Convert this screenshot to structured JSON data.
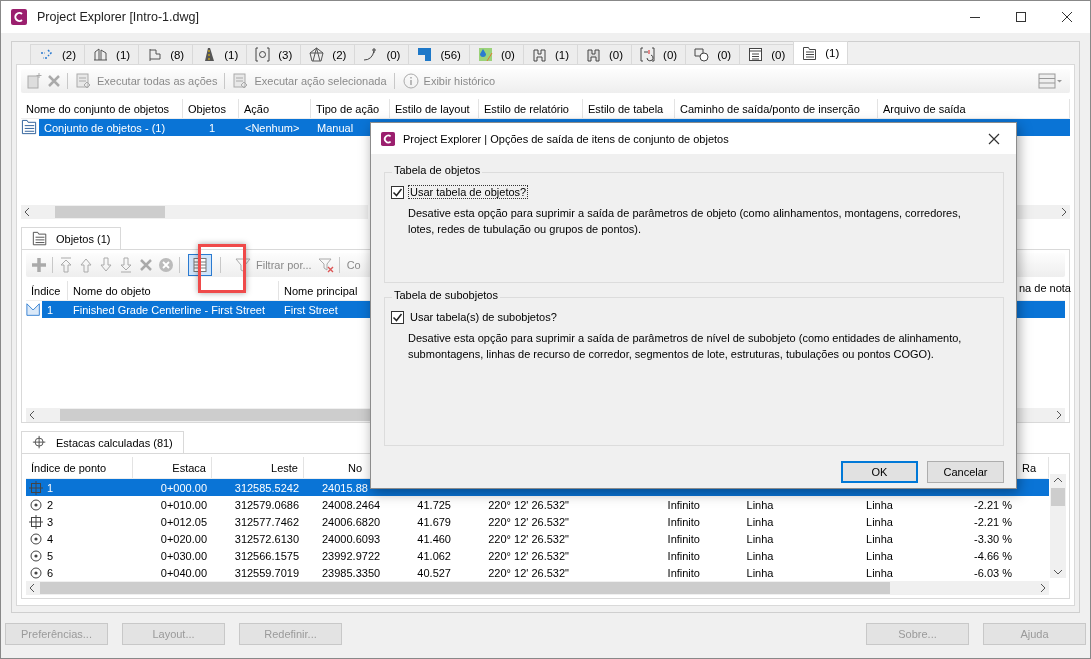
{
  "window": {
    "title": "Project Explorer [Intro-1.dwg]"
  },
  "object_tabs": [
    {
      "count": "(2)",
      "selected": false
    },
    {
      "count": "(1)",
      "selected": false
    },
    {
      "count": "(8)",
      "selected": false
    },
    {
      "count": "(1)",
      "selected": false
    },
    {
      "count": "(3)",
      "selected": false
    },
    {
      "count": "(2)",
      "selected": false
    },
    {
      "count": "(0)",
      "selected": false
    },
    {
      "count": "(56)",
      "selected": false
    },
    {
      "count": "(0)",
      "selected": false
    },
    {
      "count": "(1)",
      "selected": false
    },
    {
      "count": "(0)",
      "selected": false
    },
    {
      "count": "(0)",
      "selected": false
    },
    {
      "count": "(0)",
      "selected": false
    },
    {
      "count": "(0)",
      "selected": false
    },
    {
      "count": "(1)",
      "selected": true
    }
  ],
  "toolbar": {
    "actions": [
      {
        "label": "Executar todas as ações",
        "disabled": true
      },
      {
        "label": "Executar ação selecionada",
        "disabled": true
      },
      {
        "label": "Exibir histórico",
        "disabled": true
      }
    ]
  },
  "object_sets": {
    "columns": [
      "Nome do conjunto de objetos",
      "Objetos",
      "Ação",
      "Tipo de ação",
      "Estilo de layout",
      "Estilo de relatório",
      "Estilo de tabela",
      "Caminho de saída/ponto de inserção",
      "Arquivo de saída"
    ],
    "rows": [
      {
        "cells": [
          "Conjunto de objetos - (1)",
          "1",
          "<Nenhum>",
          "Manual"
        ],
        "selected": true
      }
    ]
  },
  "objects_panel": {
    "tab": "Objetos (1)",
    "table_tool_selected": true,
    "filter_label": "Filtrar por...",
    "cut_label": "Co",
    "columns": [
      "Índice",
      "Nome do objeto",
      "Nome principal"
    ],
    "last_column": "na de nota",
    "rows": [
      {
        "cells": [
          "1",
          "Finished Grade Centerline - First Street",
          "First Street"
        ],
        "selected": true
      }
    ]
  },
  "stations_panel": {
    "tab": "Estacas calculadas (81)",
    "columns": [
      "Índice de ponto",
      "Estaca",
      "Leste",
      "No"
    ],
    "last_column": "Ra",
    "rows": [
      {
        "kind": "crosshair",
        "selected": true,
        "cells": [
          "1",
          "0+000.00",
          "312585.5242",
          "24015.88"
        ]
      },
      {
        "kind": "point",
        "selected": false,
        "cells": [
          "2",
          "0+010.00",
          "312579.0686",
          "24008.2464",
          "41.725",
          "220° 12' 26.532\"",
          "Infinito",
          "Linha",
          "Linha",
          "-2.21 %"
        ]
      },
      {
        "kind": "crosshair",
        "selected": false,
        "cells": [
          "3",
          "0+012.05",
          "312577.7462",
          "24006.6820",
          "41.679",
          "220° 12' 26.532\"",
          "Infinito",
          "Linha",
          "Linha",
          "-2.21 %"
        ]
      },
      {
        "kind": "point",
        "selected": false,
        "cells": [
          "4",
          "0+020.00",
          "312572.6130",
          "24000.6093",
          "41.460",
          "220° 12' 26.532\"",
          "Infinito",
          "Linha",
          "Linha",
          "-3.30 %"
        ]
      },
      {
        "kind": "point",
        "selected": false,
        "cells": [
          "5",
          "0+030.00",
          "312566.1575",
          "23992.9722",
          "41.062",
          "220° 12' 26.532\"",
          "Infinito",
          "Linha",
          "Linha",
          "-4.66 %"
        ]
      },
      {
        "kind": "point",
        "selected": false,
        "cells": [
          "6",
          "0+040.00",
          "312559.7019",
          "23985.3350",
          "40.527",
          "220° 12' 26.532\"",
          "Infinito",
          "Linha",
          "Linha",
          "-6.03 %"
        ]
      }
    ]
  },
  "dialog": {
    "title": "Project Explorer | Opções de saída de itens de conjunto de objetos",
    "groups": [
      {
        "legend": "Tabela de objetos",
        "checkbox": {
          "label": "Usar tabela de objetos?",
          "checked": true,
          "focused": true
        },
        "description": "Desative esta opção para suprimir a saída de parâmetros de objeto (como alinhamentos, montagens, corredores, lotes, redes de tubulação ou grupos de pontos)."
      },
      {
        "legend": "Tabela de subobjetos",
        "checkbox": {
          "label": "Usar tabela(s) de subobjetos?",
          "checked": true,
          "focused": false
        },
        "description": "Desative esta opção para suprimir a saída de parâmetros de nível de subobjeto (como entidades de alinhamento, submontagens, linhas de recurso de corredor, segmentos de lote, estruturas, tubulações ou pontos COGO)."
      }
    ],
    "buttons": [
      {
        "label": "OK",
        "default": true
      },
      {
        "label": "Cancelar",
        "default": false
      }
    ]
  },
  "bottom_buttons": [
    {
      "label": "Preferências...",
      "disabled": true
    },
    {
      "label": "Layout...",
      "disabled": true
    },
    {
      "label": "Redefinir...",
      "disabled": true
    },
    {
      "label": "Sobre...",
      "disabled": true
    },
    {
      "label": "Ajuda",
      "disabled": true
    }
  ]
}
